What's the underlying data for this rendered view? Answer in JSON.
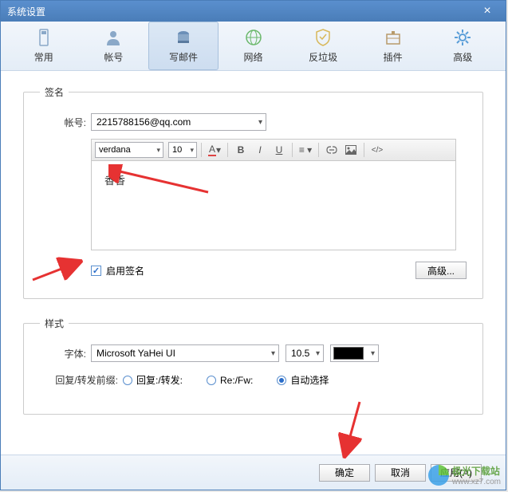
{
  "window": {
    "title": "系统设置"
  },
  "tabs": [
    {
      "label": "常用"
    },
    {
      "label": "帐号"
    },
    {
      "label": "写邮件"
    },
    {
      "label": "网络"
    },
    {
      "label": "反垃圾"
    },
    {
      "label": "插件"
    },
    {
      "label": "高级"
    }
  ],
  "signature": {
    "legend": "签名",
    "account_label": "帐号:",
    "account_value": "2215788156@qq.com",
    "editor": {
      "font": "verdana",
      "size": "10",
      "content": "香香"
    },
    "enable_label": "启用签名",
    "enable_checked": true,
    "advanced_btn": "高级..."
  },
  "style": {
    "legend": "样式",
    "font_label": "字体:",
    "font_value": "Microsoft YaHei UI",
    "size_value": "10.5",
    "prefix_label": "回复/转发前缀:",
    "options": [
      {
        "label": "回复:/转发:",
        "selected": false
      },
      {
        "label": "Re:/Fw:",
        "selected": false
      },
      {
        "label": "自动选择",
        "selected": true
      }
    ]
  },
  "footer": {
    "ok": "确定",
    "cancel": "取消",
    "apply": "应用(A)"
  },
  "watermark": {
    "text": "极光下载站",
    "url": "www.xz7.com"
  }
}
